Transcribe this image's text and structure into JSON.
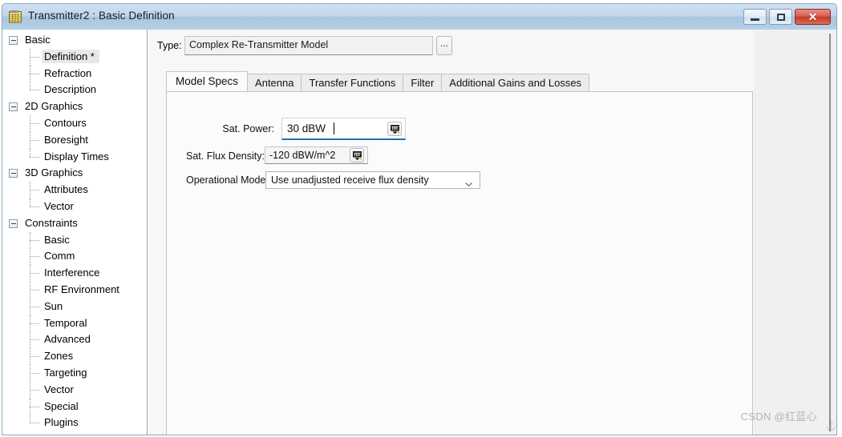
{
  "window": {
    "title": "Transmitter2 : Basic Definition",
    "icon": "grid-document-icon",
    "buttons": {
      "minimize": "minimize-icon",
      "maximize": "maximize-icon",
      "close": "✕"
    }
  },
  "tree": {
    "nodes": [
      {
        "label": "Basic",
        "level": "root",
        "expanded": true,
        "selected": false
      },
      {
        "label": "Definition *",
        "level": "child",
        "expanded": false,
        "selected": true
      },
      {
        "label": "Refraction",
        "level": "child",
        "expanded": false,
        "selected": false
      },
      {
        "label": "Description",
        "level": "child",
        "expanded": false,
        "selected": false
      },
      {
        "label": "2D Graphics",
        "level": "root",
        "expanded": true,
        "selected": false
      },
      {
        "label": "Contours",
        "level": "child",
        "expanded": false,
        "selected": false
      },
      {
        "label": "Boresight",
        "level": "child",
        "expanded": false,
        "selected": false
      },
      {
        "label": "Display Times",
        "level": "child",
        "expanded": false,
        "selected": false
      },
      {
        "label": "3D Graphics",
        "level": "root",
        "expanded": true,
        "selected": false
      },
      {
        "label": "Attributes",
        "level": "child",
        "expanded": false,
        "selected": false
      },
      {
        "label": "Vector",
        "level": "child",
        "expanded": false,
        "selected": false
      },
      {
        "label": "Constraints",
        "level": "root",
        "expanded": true,
        "selected": false
      },
      {
        "label": "Basic",
        "level": "child",
        "expanded": false,
        "selected": false
      },
      {
        "label": "Comm",
        "level": "child",
        "expanded": false,
        "selected": false
      },
      {
        "label": "Interference",
        "level": "child",
        "expanded": false,
        "selected": false
      },
      {
        "label": "RF Environment",
        "level": "child",
        "expanded": false,
        "selected": false
      },
      {
        "label": "Sun",
        "level": "child",
        "expanded": false,
        "selected": false
      },
      {
        "label": "Temporal",
        "level": "child",
        "expanded": false,
        "selected": false
      },
      {
        "label": "Advanced",
        "level": "child",
        "expanded": false,
        "selected": false
      },
      {
        "label": "Zones",
        "level": "child",
        "expanded": false,
        "selected": false
      },
      {
        "label": "Targeting",
        "level": "child",
        "expanded": false,
        "selected": false
      },
      {
        "label": "Vector",
        "level": "child",
        "expanded": false,
        "selected": false
      },
      {
        "label": "Special",
        "level": "child",
        "expanded": false,
        "selected": false
      },
      {
        "label": "Plugins",
        "level": "child",
        "expanded": false,
        "selected": false
      }
    ]
  },
  "type_row": {
    "label": "Type:",
    "value": "Complex Re-Transmitter Model",
    "browse_button": "..."
  },
  "tabs": [
    {
      "label": "Model Specs",
      "active": true
    },
    {
      "label": "Antenna",
      "active": false
    },
    {
      "label": "Transfer Functions",
      "active": false
    },
    {
      "label": "Filter",
      "active": false
    },
    {
      "label": "Additional Gains and Losses",
      "active": false
    }
  ],
  "form": {
    "sat_power": {
      "label": "Sat. Power:",
      "value": "30 dBW",
      "unit_button": "units-icon",
      "focused": true
    },
    "sat_flux_density": {
      "label": "Sat. Flux Density:",
      "value": "-120 dBW/m^2",
      "unit_button": "units-icon"
    },
    "operational_mode": {
      "label": "Operational Mode:",
      "value": "Use unadjusted receive flux density",
      "options": [
        "Use unadjusted receive flux density"
      ]
    }
  },
  "watermark": "CSDN @红蓝心",
  "colors": {
    "titlebar_top": "#cfe0ef",
    "titlebar_bottom": "#b6d0e5",
    "close_button": "#c33a28",
    "focus_underline": "#1f6fb5",
    "selection": "#e8e8e8",
    "panel": "#fbfbfb",
    "chrome": "#f0f0f0"
  }
}
